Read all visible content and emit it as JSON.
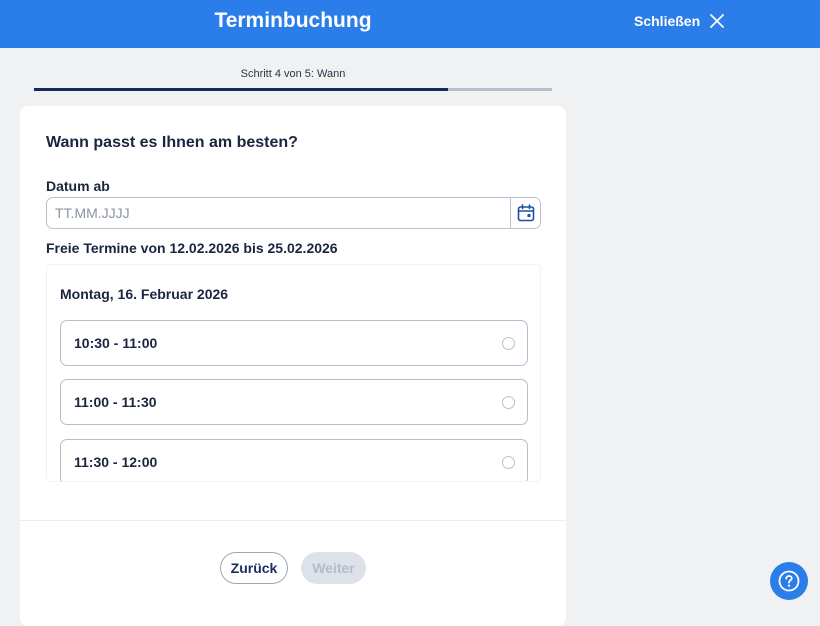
{
  "header": {
    "title": "Terminbuchung",
    "close_label": "Schließen",
    "close_icon": "close-icon"
  },
  "progress": {
    "label": "Schritt 4 von 5: Wann",
    "current_step": 4,
    "total_steps": 5
  },
  "form": {
    "heading": "Wann passt es Ihnen am besten?",
    "date_label": "Datum ab",
    "date_placeholder": "TT.MM.JJJJ",
    "date_value": "",
    "calendar_icon": "calendar-icon",
    "range_text": "Freie Termine von 12.02.2026 bis 25.02.2026"
  },
  "day": {
    "heading": "Montag, 16. Februar 2026",
    "slots": [
      {
        "label": "10:30 - 11:00",
        "selected": false
      },
      {
        "label": "11:00 - 11:30",
        "selected": false
      },
      {
        "label": "11:30 - 12:00",
        "selected": false
      }
    ]
  },
  "footer": {
    "back_label": "Zurück",
    "next_label": "Weiter",
    "next_enabled": false
  },
  "help": {
    "icon": "help-icon"
  },
  "colors": {
    "brand": "#2b7de9",
    "text": "#1a2540",
    "progress_fill": "#172a55",
    "disabled": "#dde2e9"
  }
}
